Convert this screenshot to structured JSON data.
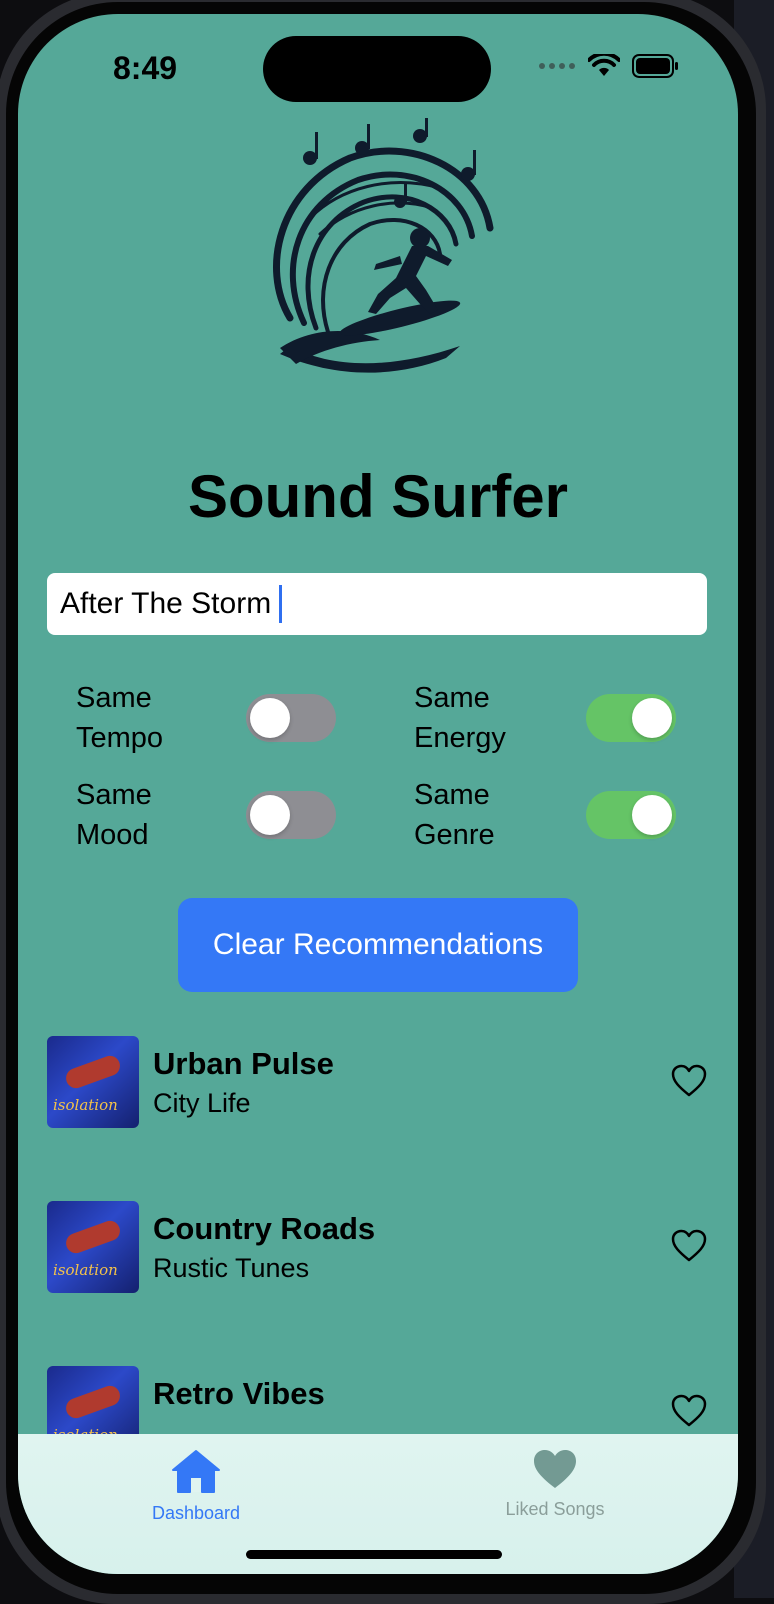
{
  "status_bar": {
    "time": "8:49"
  },
  "app": {
    "title": "Sound Surfer"
  },
  "search": {
    "value": "After The Storm"
  },
  "toggles": [
    {
      "label": "Same Tempo",
      "on": false
    },
    {
      "label": "Same Energy",
      "on": true
    },
    {
      "label": "Same Mood",
      "on": false
    },
    {
      "label": "Same Genre",
      "on": true
    }
  ],
  "clear_button": {
    "label": "Clear Recommendations"
  },
  "recommendations": [
    {
      "title": "Urban Pulse",
      "artist": "City Life",
      "album_art_text": "isolation",
      "liked": false
    },
    {
      "title": "Country Roads",
      "artist": "Rustic Tunes",
      "album_art_text": "isolation",
      "liked": false
    },
    {
      "title": "Retro Vibes",
      "artist": "",
      "album_art_text": "isolation",
      "liked": false
    }
  ],
  "tab_bar": {
    "tabs": [
      {
        "label": "Dashboard",
        "icon": "house-icon",
        "selected": true
      },
      {
        "label": "Liked Songs",
        "icon": "heart-icon",
        "selected": false
      }
    ]
  },
  "colors": {
    "background": "#55a898",
    "accent": "#3478f6",
    "toggle_on": "#65c466",
    "toggle_off": "#8e8e93",
    "tab_bar": "#dcf3ef"
  }
}
